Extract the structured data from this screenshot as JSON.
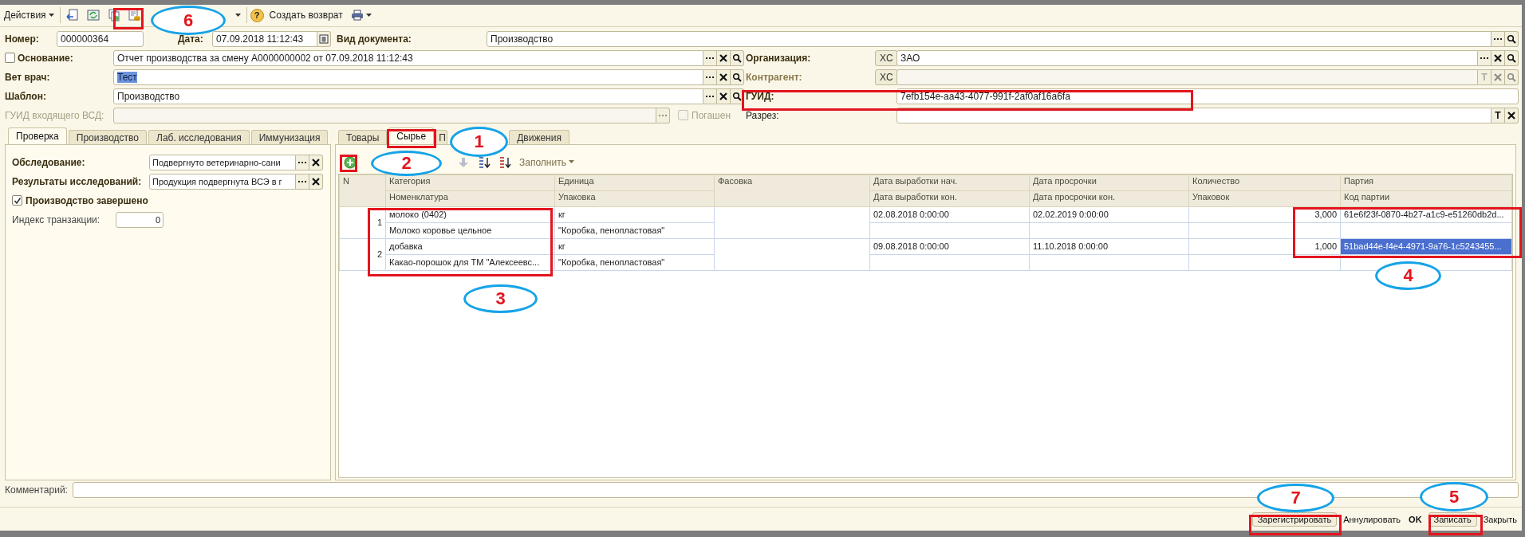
{
  "toolbar": {
    "actions_label": "Действия",
    "help_glyph": "?",
    "return_label": "Создать возврат"
  },
  "header": {
    "number": {
      "label": "Номер:",
      "value": "000000364"
    },
    "date": {
      "label": "Дата:",
      "value": "07.09.2018 11:12:43"
    },
    "doc_type": {
      "label": "Вид документа:",
      "value": "Производство"
    }
  },
  "form_rows": [
    {
      "left": {
        "label": "Основание:",
        "required": true,
        "checkbox": {
          "checked": false
        },
        "value": "Отчет производства за смену А0000000002 от 07.09.2018 11:12:43",
        "buttons": [
          {
            "kind": "choose"
          },
          {
            "kind": "clear"
          },
          {
            "kind": "search"
          }
        ]
      },
      "right": {
        "label": "Организация:",
        "required": true,
        "prefix": "XC",
        "value": "ЗАО",
        "buttons": [
          {
            "kind": "choose"
          },
          {
            "kind": "clear"
          },
          {
            "kind": "search"
          }
        ]
      }
    },
    {
      "left": {
        "label": "Вет врач:",
        "required": true,
        "value": "Тест",
        "highlighted": true,
        "buttons": [
          {
            "kind": "choose"
          },
          {
            "kind": "clear"
          },
          {
            "kind": "search"
          }
        ]
      },
      "right": {
        "label": "Контрагент:",
        "required": true,
        "disabled": true,
        "prefix": "XC",
        "buttons": [
          {
            "kind": "type",
            "label": "T"
          },
          {
            "kind": "clear"
          },
          {
            "kind": "search"
          }
        ]
      }
    },
    {
      "left": {
        "label": "Шаблон:",
        "required": true,
        "value": "Производство",
        "buttons": [
          {
            "kind": "choose"
          },
          {
            "kind": "clear"
          },
          {
            "kind": "search"
          }
        ]
      },
      "right": {
        "label": "ГУИД:",
        "required": true,
        "value": "7efb154e-aa43-4077-991f-2af0af16a6fa"
      }
    },
    {
      "left": {
        "label": "ГУИД входящего ВСД:",
        "required": false,
        "disabled": true,
        "buttons": [
          {
            "kind": "choose"
          }
        ],
        "trailing_checkbox": {
          "label": "Погашен",
          "checked": false,
          "disabled": true
        }
      },
      "right": {
        "label": "Разрез:",
        "required": false,
        "buttons": [
          {
            "kind": "type",
            "label": "T"
          },
          {
            "kind": "clear"
          }
        ]
      }
    }
  ],
  "left_tabs": [
    {
      "label": "Проверка",
      "selected": true
    },
    {
      "label": "Производство",
      "selected": false
    },
    {
      "label": "Лаб. исследования",
      "selected": false
    },
    {
      "label": "Иммунизация",
      "selected": false
    }
  ],
  "left_panel": [
    {
      "kind": "field",
      "label": "Обследование:",
      "required": true,
      "value": "Подвергнуто ветеринарно-сани",
      "buttons": [
        {
          "kind": "choose"
        },
        {
          "kind": "clear"
        }
      ]
    },
    {
      "kind": "field",
      "label": "Результаты исследований:",
      "required": true,
      "value": "Продукция подвергнута ВСЭ в г",
      "buttons": [
        {
          "kind": "choose"
        },
        {
          "kind": "clear"
        }
      ]
    },
    {
      "kind": "checkbox",
      "label": "Производство завершено",
      "checked": true
    },
    {
      "kind": "number",
      "label": "Индекс транзакции:",
      "required": false,
      "value": "0"
    }
  ],
  "right_tabs": [
    {
      "label": "Товары",
      "selected": false
    },
    {
      "label": "Сырье",
      "selected": true
    },
    {
      "label": "П",
      "selected": false
    },
    {
      "label": "Движения",
      "selected": false
    }
  ],
  "table_toolbar": {
    "fill_label": "Заполнить"
  },
  "table": {
    "columns": [
      {
        "top": "N",
        "kind": "number"
      },
      {
        "top": "Категория",
        "bottom": "Номенклатура"
      },
      {
        "top": "Единица",
        "bottom": "Упаковка"
      },
      {
        "top": "Фасовка"
      },
      {
        "top": "Дата выработки нач.",
        "bottom": "Дата выработки кон."
      },
      {
        "top": "Дата просрочки",
        "bottom": "Дата просрочки кон."
      },
      {
        "top": "Количество",
        "bottom": "Упаковок",
        "kind": "number"
      },
      {
        "top": "Партия",
        "bottom": "Код партии"
      }
    ],
    "rows": [
      {
        "selected": false,
        "cells": [
          [
            "1"
          ],
          [
            "молоко (0402)",
            "Молоко коровье цельное"
          ],
          [
            "кг",
            "\"Коробка, пенопластовая\""
          ],
          null,
          [
            "02.08.2018 0:00:00"
          ],
          [
            "02.02.2019 0:00:00"
          ],
          [
            "3,000"
          ],
          [
            "61e6f23f-0870-4b27-a1c9-e51260db2d..."
          ]
        ]
      },
      {
        "selected": true,
        "cells": [
          [
            "2"
          ],
          [
            "добавка",
            "Какао-порошок для ТМ \"Алексеевс..."
          ],
          [
            "кг",
            "\"Коробка, пенопластовая\""
          ],
          null,
          [
            "09.08.2018 0:00:00"
          ],
          [
            "11.10.2018 0:00:00"
          ],
          [
            "1,000"
          ],
          [
            "51bad44e-f4e4-4971-9a76-1c5243455..."
          ]
        ]
      }
    ]
  },
  "comment": {
    "label": "Комментарий:"
  },
  "footer_buttons": [
    {
      "label": "Зарегистрировать",
      "kind": "button"
    },
    {
      "label": "Аннулировать",
      "kind": "flat"
    },
    {
      "label": "OK",
      "kind": "flat",
      "default": true
    },
    {
      "label": "Записать",
      "kind": "button"
    },
    {
      "label": "Закрыть",
      "kind": "flat"
    }
  ],
  "annotations": [
    {
      "kind": "frame"
    },
    {
      "kind": "callout",
      "label": "6"
    },
    {
      "kind": "frame"
    },
    {
      "kind": "frame"
    },
    {
      "kind": "callout",
      "label": "1"
    },
    {
      "kind": "frame"
    },
    {
      "kind": "callout",
      "label": "2"
    },
    {
      "kind": "frame"
    },
    {
      "kind": "callout",
      "label": "3"
    },
    {
      "kind": "frame"
    },
    {
      "kind": "callout",
      "label": "4"
    },
    {
      "kind": "callout",
      "label": "7"
    },
    {
      "kind": "frame"
    },
    {
      "kind": "callout",
      "label": "5"
    },
    {
      "kind": "frame"
    }
  ]
}
